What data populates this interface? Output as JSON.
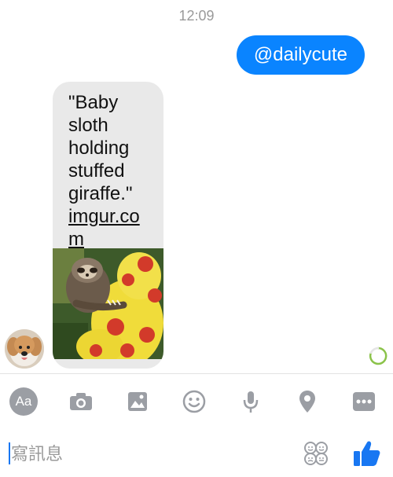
{
  "conversation": {
    "timestamp": "12:09",
    "outgoing_message": "@dailycute",
    "incoming_message": {
      "caption": "\"Baby sloth holding stuffed giraffe.\"",
      "link": "imgur.com",
      "image_icon": "sloth-photo"
    },
    "sender_avatar_icon": "puppy-avatar",
    "status_icon": "sending-spinner-icon"
  },
  "toolbar": {
    "aa_label": "Aa",
    "icons": [
      "camera-icon",
      "gallery-icon",
      "emoji-icon",
      "microphone-icon",
      "location-icon",
      "more-icon"
    ]
  },
  "composer": {
    "placeholder": "寫訊息",
    "sticker_icon": "sticker-icon",
    "like_icon": "thumbs-up-icon"
  },
  "colors": {
    "accent": "#0a84ff",
    "incoming_bubble": "#e9e9e9",
    "icon_gray": "#9b9ea4",
    "like_blue": "#1877f2"
  }
}
